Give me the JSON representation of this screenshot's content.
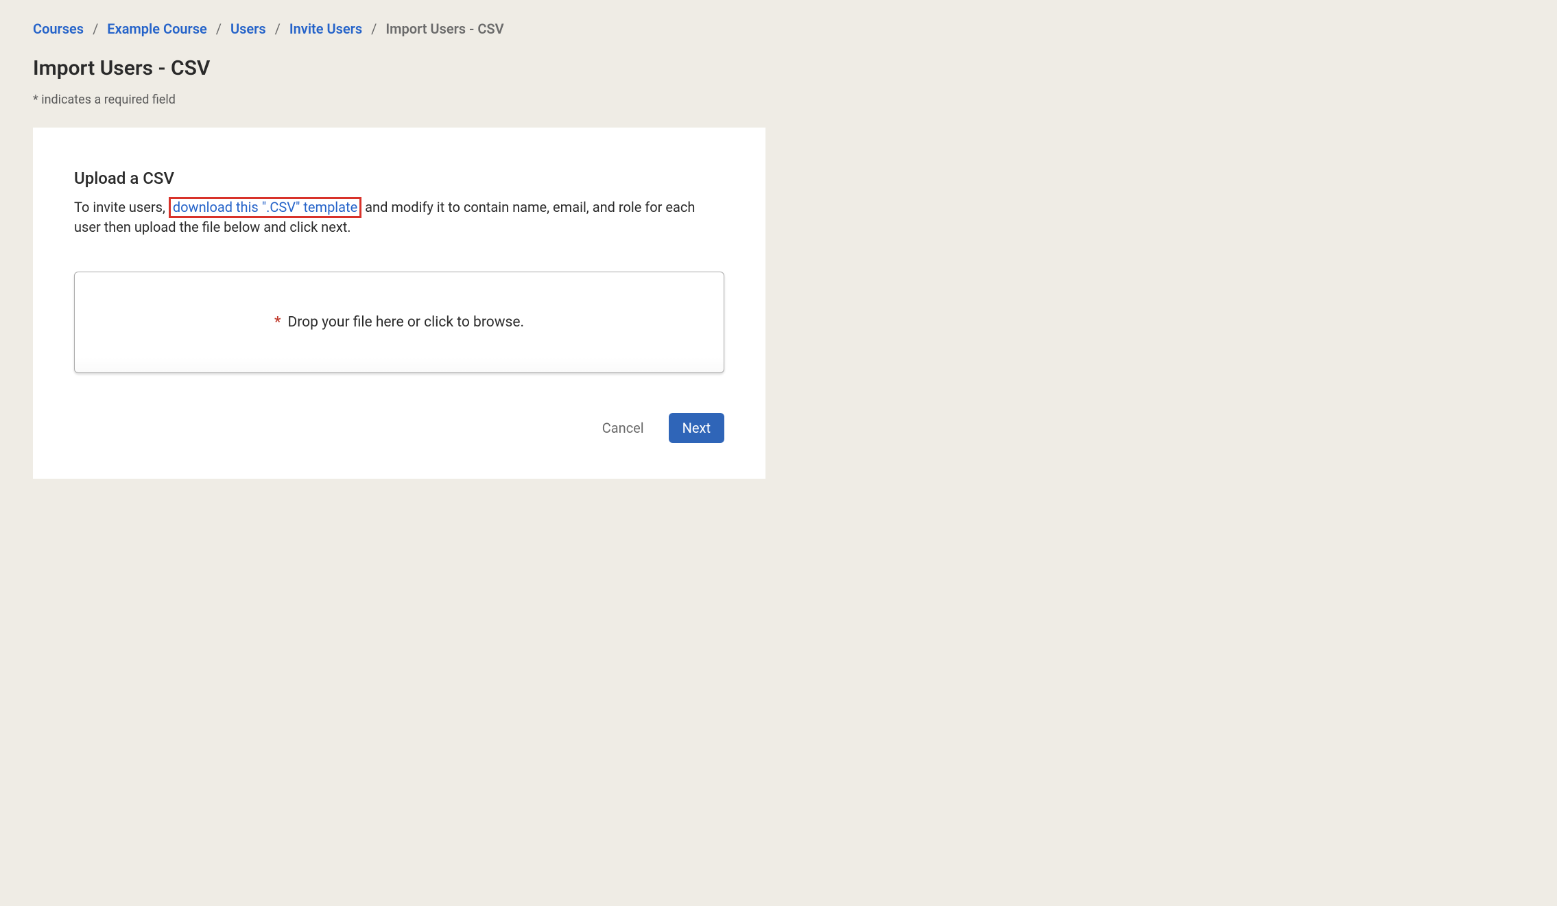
{
  "breadcrumb": {
    "items": [
      {
        "label": "Courses",
        "link": true
      },
      {
        "label": "Example Course",
        "link": true
      },
      {
        "label": "Users",
        "link": true
      },
      {
        "label": "Invite Users",
        "link": true
      },
      {
        "label": "Import Users - CSV",
        "link": false
      }
    ],
    "separator": "/"
  },
  "page": {
    "title": "Import Users - CSV",
    "required_note": "* indicates a required field"
  },
  "upload": {
    "section_title": "Upload a CSV",
    "desc_prefix": "To invite users, ",
    "download_link_label": "download this \".CSV\" template",
    "desc_suffix": " and modify it to contain name, email, and role for each user then upload the file below and click next."
  },
  "dropzone": {
    "asterisk": "*",
    "text": "Drop your file here or click to browse."
  },
  "buttons": {
    "cancel": "Cancel",
    "next": "Next"
  }
}
